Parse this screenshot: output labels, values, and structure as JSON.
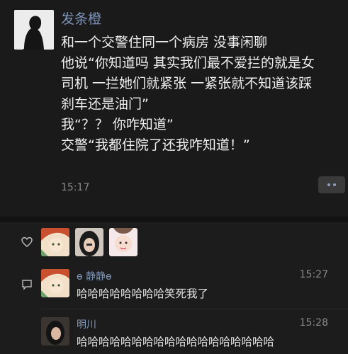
{
  "post": {
    "author": "发条橙",
    "lines": [
      "和一个交警住同一个病房 没事闲聊",
      "他说“你知道吗 其实我们最不爱拦的就是女",
      "司机 一拦她们就紧张 一紧张就不知道该踩",
      "刹车还是油门”",
      "我“？？ 你咋知道”",
      "交警“我都住院了还我咋知道！”"
    ],
    "time": "15:17"
  },
  "icons": {
    "like": "heart-icon",
    "comment": "comment-icon",
    "more": "more-dots-icon"
  },
  "comments": [
    {
      "name": "ɵ 静静ɵ",
      "time": "15:27",
      "text": "哈哈哈哈哈哈哈哈笑死我了"
    },
    {
      "name": "明川",
      "time": "15:28",
      "text": "哈哈哈哈哈哈哈哈哈哈哈哈哈哈哈哈哈哈"
    }
  ],
  "colors": {
    "name_link": "#7f95b8",
    "background": "#1a1a1a"
  }
}
